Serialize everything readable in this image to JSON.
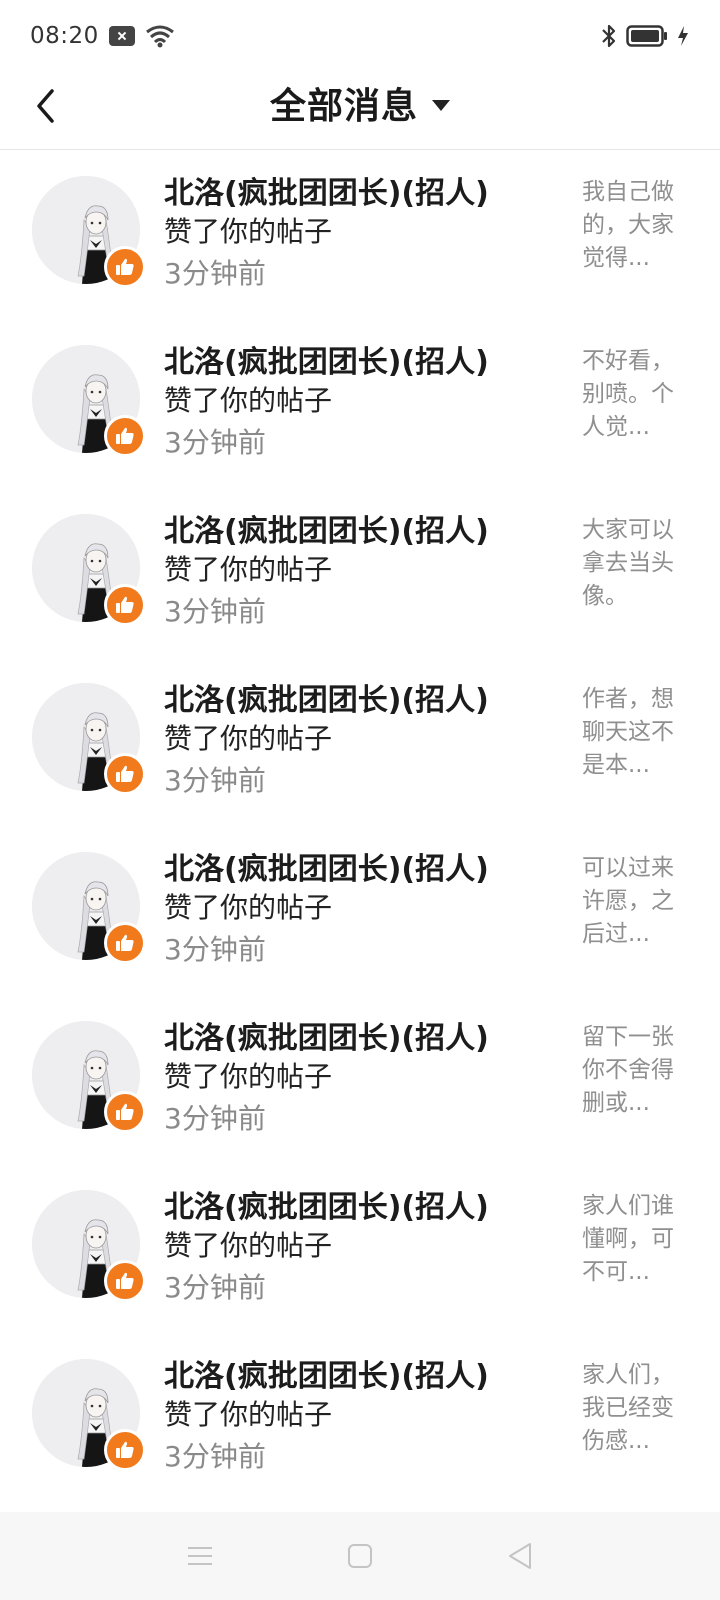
{
  "status_bar": {
    "time": "08:20",
    "icons": [
      "notification-x-icon",
      "wifi-icon",
      "bluetooth-icon",
      "battery-icon",
      "charging-icon"
    ]
  },
  "header": {
    "title": "全部消息",
    "back_icon": "chevron-left-icon",
    "dropdown_icon": "caret-down-icon"
  },
  "messages": [
    {
      "name": "北洛(疯批团团长)(招人)",
      "action": "赞了你的帖子",
      "time": "3分钟前",
      "preview": "我自己做的，大家觉得..."
    },
    {
      "name": "北洛(疯批团团长)(招人)",
      "action": "赞了你的帖子",
      "time": "3分钟前",
      "preview": "不好看，别喷。个人觉..."
    },
    {
      "name": "北洛(疯批团团长)(招人)",
      "action": "赞了你的帖子",
      "time": "3分钟前",
      "preview": "大家可以拿去当头像。"
    },
    {
      "name": "北洛(疯批团团长)(招人)",
      "action": "赞了你的帖子",
      "time": "3分钟前",
      "preview": "作者，想聊天这不是本..."
    },
    {
      "name": "北洛(疯批团团长)(招人)",
      "action": "赞了你的帖子",
      "time": "3分钟前",
      "preview": "可以过来许愿，之后过..."
    },
    {
      "name": "北洛(疯批团团长)(招人)",
      "action": "赞了你的帖子",
      "time": "3分钟前",
      "preview": "留下一张你不舍得删或..."
    },
    {
      "name": "北洛(疯批团团长)(招人)",
      "action": "赞了你的帖子",
      "time": "3分钟前",
      "preview": "家人们谁懂啊，可不可..."
    },
    {
      "name": "北洛(疯批团团长)(招人)",
      "action": "赞了你的帖子",
      "time": "3分钟前",
      "preview": "家人们，我已经变伤感..."
    }
  ],
  "badge": {
    "icon": "thumbs-up-icon",
    "color": "#f07a1c"
  },
  "nav_bar": {
    "icons": [
      "menu-icon",
      "home-square-icon",
      "back-triangle-icon"
    ]
  }
}
